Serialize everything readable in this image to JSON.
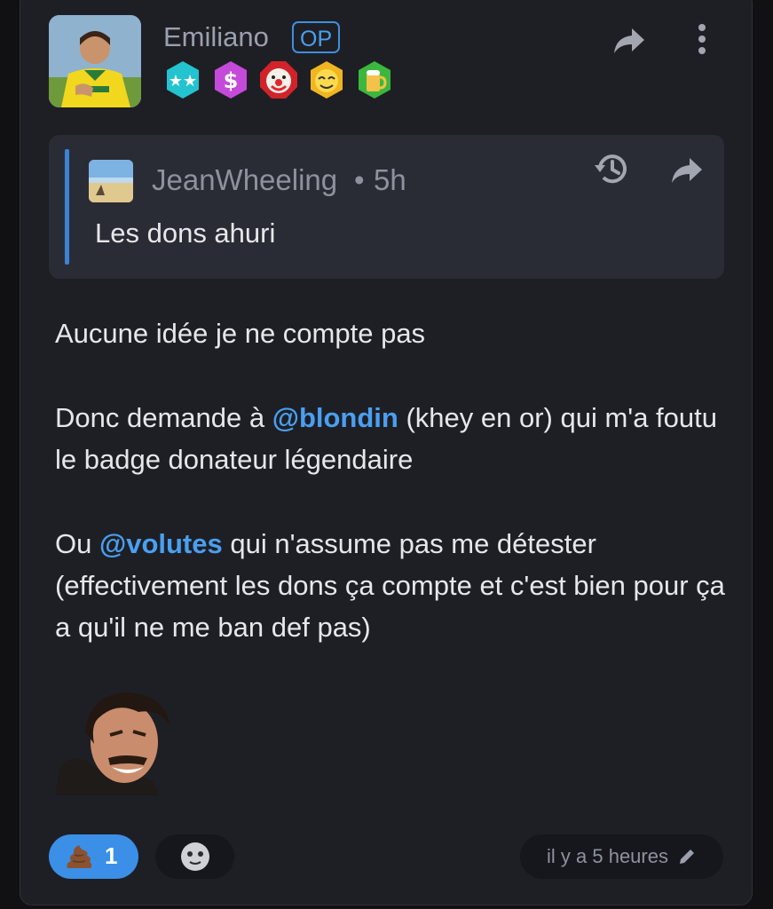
{
  "post": {
    "author": "Emiliano",
    "op_label": "OP",
    "badges": [
      "teal-stars-badge",
      "purple-dollar-badge",
      "red-clown-badge",
      "gold-face-badge",
      "green-beer-badge"
    ]
  },
  "quote": {
    "author": "JeanWheeling",
    "separator": "•",
    "time": "5h",
    "text": "Les dons ahuri"
  },
  "body": {
    "line1": "Aucune idée je ne compte pas",
    "p2_before": "Donc demande à ",
    "p2_mention": "@blondin",
    "p2_after": " (khey en or) qui m'a foutu le badge donateur légendaire",
    "p3_before": "Ou ",
    "p3_mention": "@volutes",
    "p3_after": " qui n'assume pas me détester (effectivement les dons ça compte et c'est bien pour ça a qu'il ne me ban def pas)"
  },
  "footer": {
    "reaction_emoji": "poop-icon",
    "reaction_count": "1",
    "timestamp": "il y a 5 heures"
  },
  "colors": {
    "card_bg": "#1e1f25",
    "quote_bg": "#2a2c35",
    "accent": "#3b8fe6",
    "mention": "#4a9ff0",
    "muted_text": "#8d929e"
  }
}
